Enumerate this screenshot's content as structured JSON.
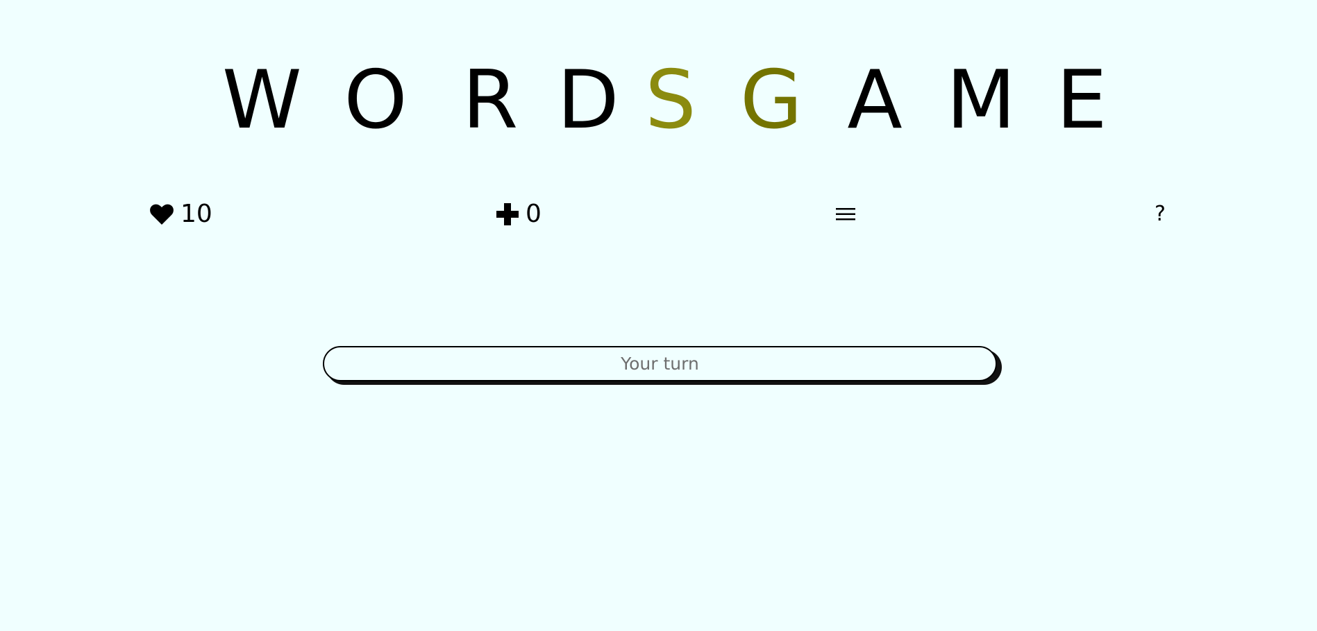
{
  "title": {
    "letters": [
      {
        "char": "W",
        "color": "#000000"
      },
      {
        "char": "O",
        "color": "#000000"
      },
      {
        "char": "R",
        "color": "#000000"
      },
      {
        "char": "D",
        "color": "#000000"
      },
      {
        "char": "S",
        "color": "#8b8b0f"
      },
      {
        "char": "G",
        "color": "#747400"
      },
      {
        "char": "A",
        "color": "#000000"
      },
      {
        "char": "M",
        "color": "#000000"
      },
      {
        "char": "E",
        "color": "#000000"
      }
    ]
  },
  "stats": {
    "lives": {
      "icon": "heart-icon",
      "value": "10"
    },
    "points": {
      "icon": "plus-icon",
      "value": "0"
    }
  },
  "menu": {
    "icon": "hamburger-menu-icon"
  },
  "help": {
    "label": "?"
  },
  "turn_input": {
    "value": "",
    "placeholder": "Your turn"
  },
  "colors": {
    "background": "#f0ffff",
    "accent_s": "#8b8b0f",
    "accent_g": "#747400"
  }
}
